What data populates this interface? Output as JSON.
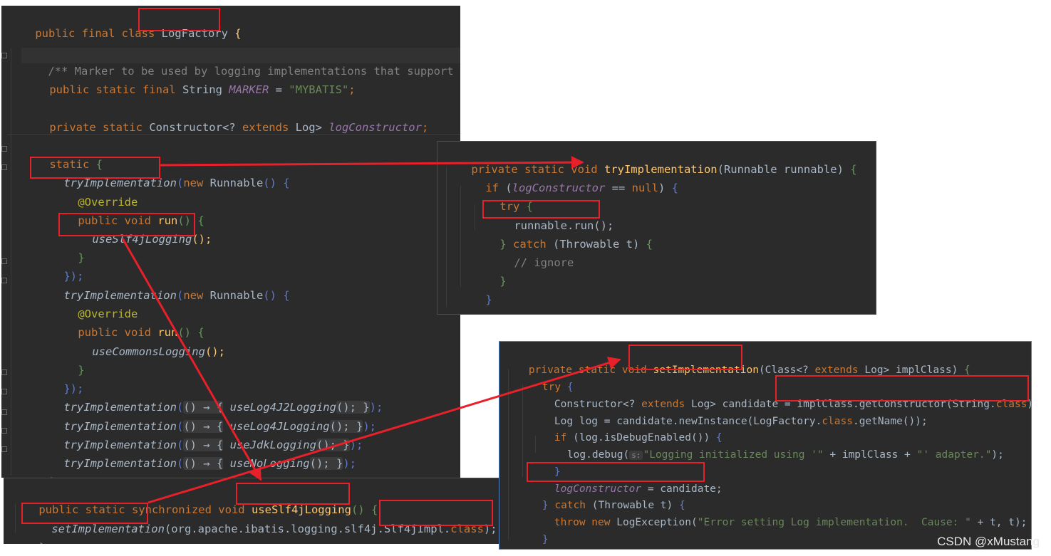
{
  "colors": {
    "background": "#2b2b2b",
    "default": "#a9b7c6",
    "keyword": "#cc7832",
    "method_declaration": "#ffc66d",
    "static_field": "#9876aa",
    "string": "#6a8759",
    "comment": "#808080",
    "annotation": "#bbb529",
    "highlight_box": "#e8202a"
  },
  "logfactory": {
    "class_decl": {
      "kw": "public final class ",
      "name": "LogFactory",
      "brace": " {"
    },
    "javadoc": "/** Marker to be used by logging implementations that support",
    "marker": {
      "kw": "public static final ",
      "type": "String ",
      "name": "MARKER",
      "eq": " = ",
      "value": "\"MYBATIS\"",
      "end": ";"
    },
    "ctor": {
      "kw": "private static ",
      "type": "Constructor<? ",
      "kw2": "extends",
      "type2": " Log> ",
      "name": "logConstructor",
      "end": ";"
    },
    "static_block": {
      "kw": "static",
      "brace": " {"
    },
    "try1": {
      "call": "tryImplementation",
      "paren": "(",
      "kw": "new ",
      "type": "Runnable",
      "rest": "() {"
    },
    "override": "@Override",
    "run": {
      "kw": "public void ",
      "name": "run",
      "paren": "()",
      "brace": " {"
    },
    "use_slf4j_call": "useSlf4jLogging",
    "call_end": "();",
    "close_brace": "}",
    "close_paren": "});",
    "use_commons_call": "useCommonsLogging",
    "lambda_arrow": "() → {",
    "lambda_calls": [
      "useLog4J2Logging",
      "useLog4JLogging",
      "useJdkLogging",
      "useNoLogging"
    ],
    "lambda_end": "});",
    "block_close": "}"
  },
  "use_slf4j_method": {
    "kw": "public static synchronized void ",
    "name": "useSlf4jLogging",
    "paren": "()",
    "brace": " {",
    "set_call": "setImplementation",
    "pkg": "(org.apache.ibatis.logging.slf4j.",
    "cls": "Slf4jImpl.",
    "class_kw": "class",
    "end": ");",
    "close": "}"
  },
  "try_impl_method": {
    "decl_kw": "private static void ",
    "decl_name": "tryImplementation",
    "decl_params": "(Runnable runnable)",
    "brace": " {",
    "if_kw": "if",
    "if_open": " (",
    "field": "logConstructor",
    "eq": " == ",
    "null_kw": "null",
    "if_close": ")",
    "try_kw": "try",
    "run_call": "runnable.run();",
    "catch_close": "} ",
    "catch_kw": "catch",
    "catch_params": " (Throwable t)",
    "comment": "// ignore",
    "close": "}"
  },
  "set_impl_method": {
    "decl_kw": "private static void ",
    "decl_name": "setImplementation",
    "decl_params_a": "(Class<? ",
    "decl_extends": "extends",
    "decl_params_b": " Log> implClass)",
    "brace": " {",
    "try_kw": "try",
    "ctor_type": "Constructor<? ",
    "ctor_extends": "extends",
    "ctor_rest": " Log> candidate = ",
    "get_ctor": "implClass.getConstructor(String.",
    "class_kw": "class",
    "get_ctor_end": ");",
    "new_inst_a": "Log log = candidate.newInstance(LogFactory.",
    "new_inst_b": ".getName());",
    "if_kw": "if",
    "if_rest": " (log.isDebugEnabled())",
    "debug_a": "log.debug(",
    "hint": "s:",
    "debug_str1": "\"Logging initialized using '\"",
    "debug_mid": " + implClass + ",
    "debug_str2": "\"' adapter.\"",
    "debug_end": ");",
    "close": "}",
    "assign_field": "logConstructor",
    "assign_rest": " = candidate;",
    "catch_close": "} ",
    "catch_kw": "catch",
    "catch_params": " (Throwable t)",
    "throw_kw": "throw new ",
    "throw_type": "LogException(",
    "throw_str": "\"Error setting Log implementation.  Cause: \"",
    "throw_end": " + t, t);"
  },
  "watermark": "CSDN @xMustang"
}
